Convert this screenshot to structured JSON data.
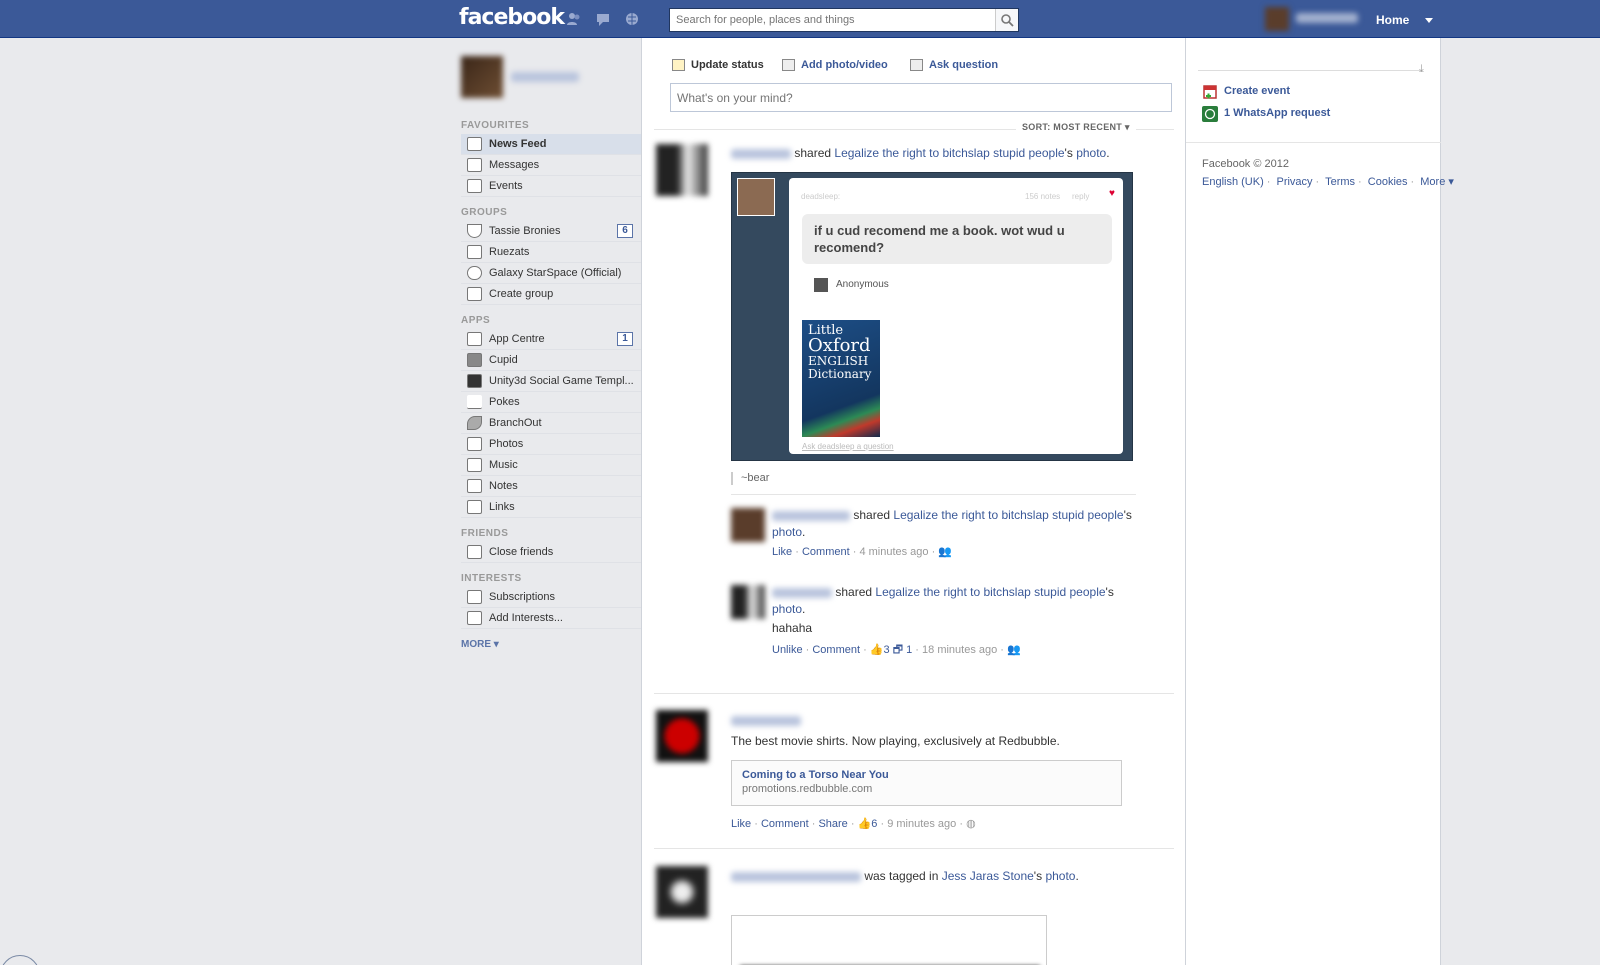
{
  "topbar": {
    "logo": "facebook",
    "search_placeholder": "Search for people, places and things",
    "home_label": "Home",
    "icons": [
      "friend-requests-icon",
      "messages-icon",
      "notifications-icon",
      "search-icon"
    ]
  },
  "sidebar": {
    "favourites_header": "FAVOURITES",
    "favourites": [
      {
        "label": "News Feed",
        "icon": "news-feed-icon"
      },
      {
        "label": "Messages",
        "icon": "messages-icon"
      },
      {
        "label": "Events",
        "icon": "events-icon"
      }
    ],
    "groups_header": "GROUPS",
    "groups": [
      {
        "label": "Tassie Bronies",
        "count": "6"
      },
      {
        "label": "Ruezats"
      },
      {
        "label": "Galaxy StarSpace (Official)"
      },
      {
        "label": "Create group"
      }
    ],
    "apps_header": "APPS",
    "apps": [
      {
        "label": "App Centre",
        "count": "1"
      },
      {
        "label": "Cupid"
      },
      {
        "label": "Unity3d Social Game Templ..."
      },
      {
        "label": "Pokes"
      },
      {
        "label": "BranchOut"
      },
      {
        "label": "Photos"
      },
      {
        "label": "Music"
      },
      {
        "label": "Notes"
      },
      {
        "label": "Links"
      }
    ],
    "friends_header": "FRIENDS",
    "friends": [
      {
        "label": "Close friends"
      }
    ],
    "interests_header": "INTERESTS",
    "interests": [
      {
        "label": "Subscriptions"
      },
      {
        "label": "Add Interests..."
      }
    ],
    "more_label": "MORE"
  },
  "composer": {
    "update_status": "Update status",
    "add_photo": "Add photo/video",
    "ask_question": "Ask question",
    "placeholder": "What's on your mind?"
  },
  "feed": {
    "sort_label": "SORT: MOST RECENT",
    "story1": {
      "verb": "shared",
      "page_link": "Legalize the right to bitchslap stupid people",
      "possessive": "'s",
      "photo_link": "photo",
      "period": ".",
      "photo": {
        "blog": "deadsleep:",
        "notes": "156 notes",
        "reply": "reply",
        "question": "if u cud recomend me a book. wot wud u recomend?",
        "asker": "Anonymous",
        "book_line1": "Little",
        "book_line2": "Oxford",
        "book_line3": "ENGLISH",
        "book_line4": "Dictionary",
        "ask_link": "Ask deadsleep a question"
      },
      "caption": "~bear"
    },
    "share1": {
      "verb": "shared",
      "page_link_a": "Legalize the right to bitchslap stupid",
      "page_link_b": "people",
      "possessive": "'s",
      "photo_link": "photo",
      "period": ".",
      "like": "Like",
      "comment": "Comment",
      "time": "4 minutes ago"
    },
    "share2": {
      "verb": "shared",
      "page_link": "Legalize the right to bitchslap stupid people",
      "possessive": "'s",
      "photo_link": "photo",
      "period": ".",
      "message": "hahaha",
      "unlike": "Unlike",
      "comment": "Comment",
      "likes": "3",
      "shares": "1",
      "time": "18 minutes ago"
    },
    "ad": {
      "text": "The best movie shirts. Now playing, exclusively at Redbubble.",
      "link_title": "Coming to a Torso Near You",
      "link_url": "promotions.redbubble.com",
      "like": "Like",
      "comment": "Comment",
      "share": "Share",
      "likes": "6",
      "time": "9 minutes ago"
    },
    "story3": {
      "verb": "was tagged in",
      "person_link": "Jess Jaras Stone",
      "possessive": "'s",
      "photo_link": "photo",
      "period": "."
    }
  },
  "rightcol": {
    "create_event": "Create event",
    "whatsapp_request": "1 WhatsApp request",
    "copyright": "Facebook © 2012",
    "footer": [
      "English (UK)",
      "Privacy",
      "Terms",
      "Cookies",
      "More"
    ]
  }
}
